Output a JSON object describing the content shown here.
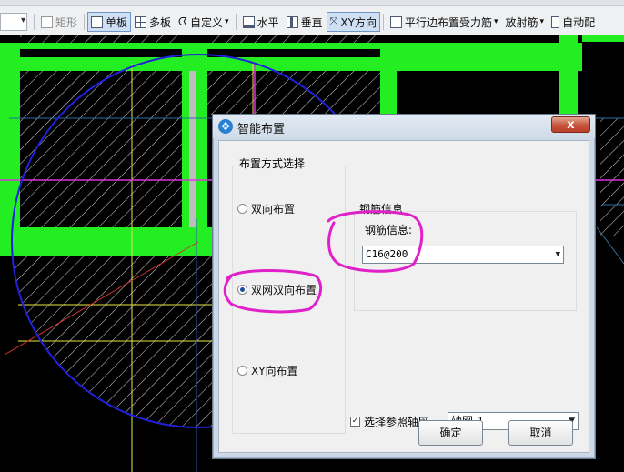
{
  "toolbar": {
    "items": [
      {
        "id": "rect",
        "label": "矩形"
      },
      {
        "id": "single",
        "label": "单板"
      },
      {
        "id": "multi",
        "label": "多板"
      },
      {
        "id": "custom",
        "label": "自定义"
      },
      {
        "id": "horizontal",
        "label": "水平"
      },
      {
        "id": "vertical",
        "label": "垂直"
      },
      {
        "id": "xy",
        "label": "XY方向"
      },
      {
        "id": "parallel",
        "label": "平行边布置受力筋"
      },
      {
        "id": "radial",
        "label": "放射筋"
      },
      {
        "id": "auto",
        "label": "自动配"
      }
    ]
  },
  "dialog": {
    "title": "智能布置",
    "close_label": "x",
    "mode_group_label": "布置方式选择",
    "options": [
      "双向布置",
      "双网双向布置",
      "XY向布置"
    ],
    "selected_option": "双网双向布置",
    "rebar_group_label": "钢筋信息",
    "rebar_field_label": "钢筋信息:",
    "rebar_value": "C16@200",
    "ref_axis_checkbox_label": "选择参照轴网",
    "ref_axis_checked": true,
    "ref_axis_value": "轴网-1",
    "ok_label": "确定",
    "cancel_label": "取消"
  },
  "colors": {
    "beam": "#22ee22",
    "circle": "#2020dd",
    "axis_yellow": "#e8e840",
    "rebar_magenta": "#dd33dd",
    "annotation": "#e020c8"
  }
}
